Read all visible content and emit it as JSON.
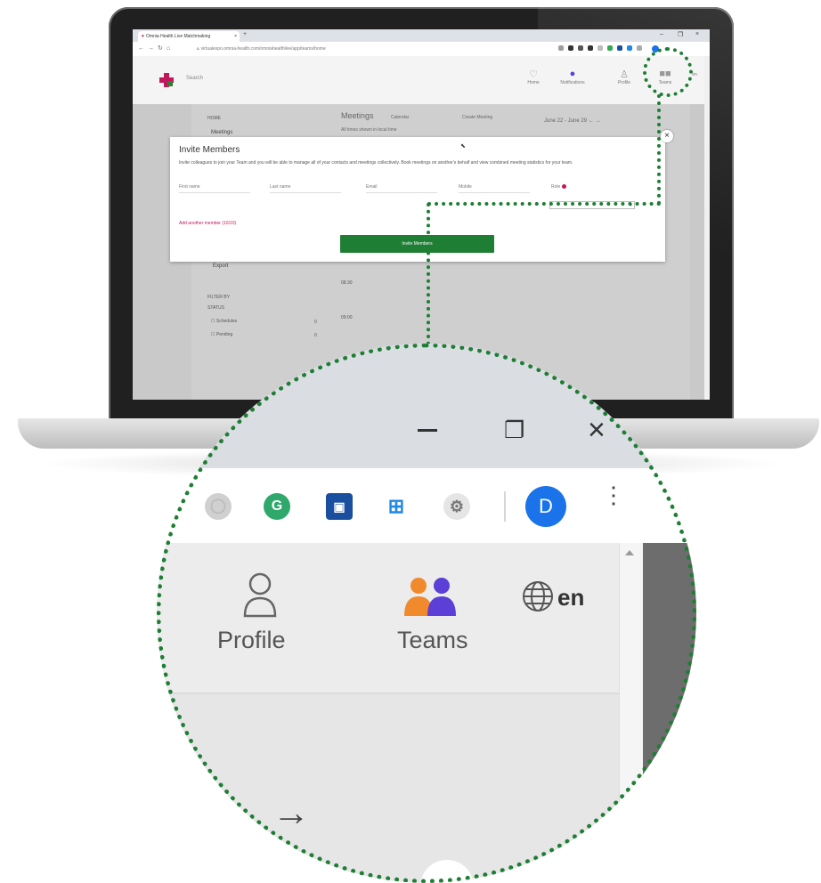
{
  "browser": {
    "tab_title": "Omnia Health Live Matchmaking",
    "tab_close": "×",
    "new_tab": "+",
    "url": "virtualexpo.omnia-health.com/omniahealthlive/app/teams/home",
    "window_controls": {
      "minimize": "–",
      "maximize": "❐",
      "close": "×"
    },
    "account_initial": "D"
  },
  "app": {
    "search_placeholder": "Search",
    "nav": [
      {
        "label": "Home",
        "icon": "home-icon"
      },
      {
        "label": "Notifications",
        "icon": "bell-icon"
      },
      {
        "label": "Profile",
        "icon": "profile-icon"
      },
      {
        "label": "Teams",
        "icon": "teams-icon"
      }
    ],
    "language": "en"
  },
  "page": {
    "sidebar_home": "HOME",
    "sidebar_meetings": "Meetings",
    "sidebar_export": "Export",
    "filter_by": "FILTER BY",
    "status": "STATUS",
    "filters": [
      {
        "label": "Schedules",
        "count": "0"
      },
      {
        "label": "Pending",
        "count": "0"
      }
    ],
    "meetings_title": "Meetings",
    "calendar_tab": "Calendar",
    "create_meeting": "Create Meeting",
    "timezone_note": "All times shown in local time",
    "date_range": "June 22 - June 29",
    "time_slots": [
      "08:30",
      "09:00"
    ]
  },
  "modal": {
    "title": "Invite Members",
    "description": "Invite colleagues to join your Team and you will be able to manage all of your contacts and meetings collectively. Book meetings on another's behalf and view combined meeting statistics for your team.",
    "fields": {
      "first_name": "First name",
      "last_name": "Last name",
      "email": "Email",
      "mobile": "Mobile",
      "role": "Role"
    },
    "add_another": "Add another member (10/10)",
    "invite_button": "Invite Members",
    "close": "×"
  },
  "zoom": {
    "minimize": "–",
    "maximize": "❐",
    "close": "×",
    "extensions": [
      "grammarly-icon",
      "screencast-icon",
      "windows-icon",
      "settings-icon"
    ],
    "grammarly_letter": "G",
    "avatar_letter": "D",
    "profile_label": "Profile",
    "teams_label": "Teams",
    "language": "en",
    "arrow": "→"
  },
  "colors": {
    "accent_green": "#1e7e34",
    "brand_magenta": "#c2185b",
    "chrome_blue": "#1a73e8",
    "teams_orange": "#f08a2c",
    "teams_purple": "#5b3fd6"
  }
}
